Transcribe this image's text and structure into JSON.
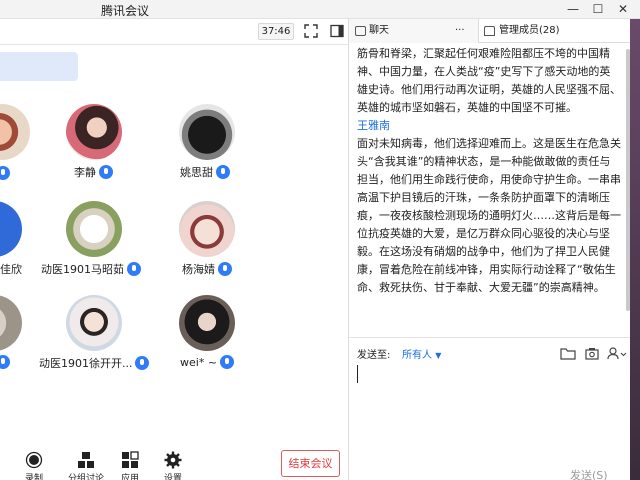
{
  "window": {
    "title": "腾讯会议",
    "minimize_glyph": "—",
    "maximize_glyph": "☐",
    "close_glyph": "✕"
  },
  "meeting": {
    "timer": "37:46",
    "participants": [
      {
        "name": "李静"
      },
      {
        "name": "姚思甜"
      },
      {
        "name": "佳欣"
      },
      {
        "name": "动医1901马昭茹"
      },
      {
        "name": "杨海婧"
      },
      {
        "name": "动医1901徐开开..."
      },
      {
        "name": "wei* ~"
      }
    ]
  },
  "toolbar": {
    "items": [
      {
        "label": "录制"
      },
      {
        "label": "分组讨论"
      },
      {
        "label": "应用"
      },
      {
        "label": "设置"
      }
    ],
    "end_label": "结束会议"
  },
  "panel": {
    "tabs": {
      "chat": "聊天",
      "more": "···",
      "members": "管理成员(28)"
    },
    "messages_before": [
      "筋骨和脊梁，汇聚起任何艰难险阻都压不垮的中国精",
      "神、中国力量，在人类战“疫”史写下了感天动地的英",
      "雄史诗。他们用行动再次证明，英雄的人民坚强不屈、",
      "英雄的城市坚如磐石，英雄的中国坚不可摧。"
    ],
    "sender": "王雅南",
    "messages_after": [
      "面对未知病毒，他们选择迎难而上。这是医生在危急关",
      "头“含我其谁”的精神状态，是一种能做敢做的责任与",
      "担当，他们用生命践行使命，用使命守护生命。一串串",
      "高温下护目镜后的汗珠，一条条防护面罩下的清晰压",
      "痕，一夜夜核酸检测现场的通明灯火……这背后是每一",
      "位抗疫英雄的大爱，是亿万群众同心驱役的决心与坚",
      "毅。在这场没有硝烟的战争中，他们为了捍卫人民健",
      "康，冒着危险在前线冲锋，用实际行动诠释了“敬佑生",
      "命、救死扶伤、甘于奉献、大爱无疆”的崇高精神。"
    ],
    "send_to_label": "发送至:",
    "recipient": "所有人",
    "send_label": "发送(S)"
  },
  "colors": {
    "accent": "#2f7cf6",
    "danger": "#e33a3a",
    "sender": "#1e6fe0"
  },
  "icons": [
    "fullscreen-icon",
    "panel-toggle-icon",
    "mic-icon",
    "record-icon",
    "breakout-icon",
    "apps-icon",
    "gear-icon",
    "folder-icon",
    "screenshot-icon",
    "user-icon"
  ]
}
